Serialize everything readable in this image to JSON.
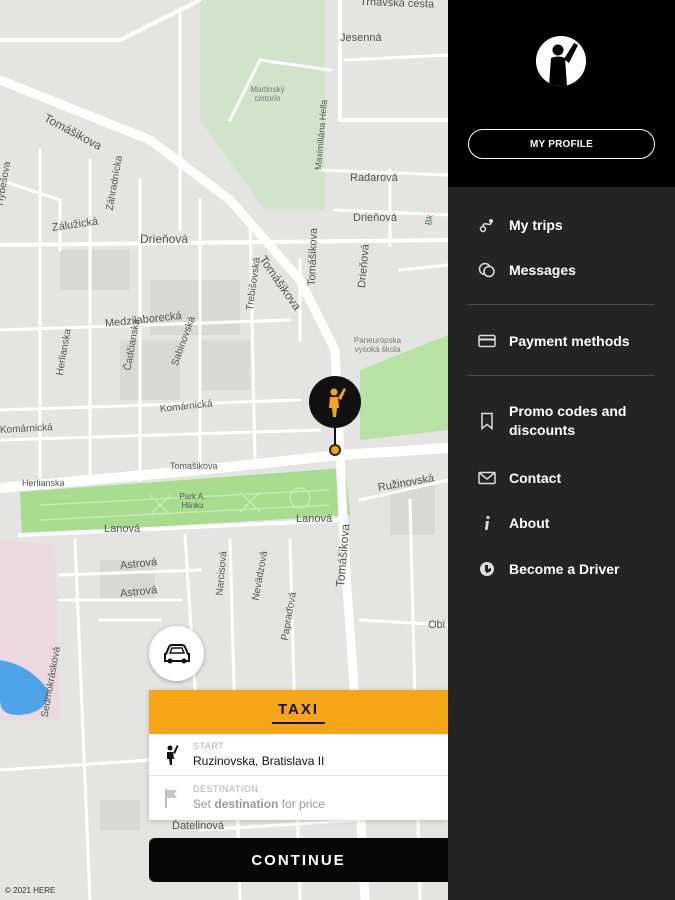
{
  "map": {
    "streets": [
      {
        "id": "trnavska",
        "text": "Trnavská cesta"
      },
      {
        "id": "jesenna",
        "text": "Jesenná"
      },
      {
        "id": "tomasikova-nw",
        "text": "Tomášikova"
      },
      {
        "id": "maximiliana-hella",
        "text": "Maximiliána Hella"
      },
      {
        "id": "radarova",
        "text": "Radarová"
      },
      {
        "id": "hybesova",
        "text": "Hybešova"
      },
      {
        "id": "zalucicka",
        "text": "Zálužická"
      },
      {
        "id": "zahradnicka",
        "text": "Záhradnícka"
      },
      {
        "id": "drienova-w",
        "text": "Drieňová"
      },
      {
        "id": "drienova-e",
        "text": "Drieňová"
      },
      {
        "id": "drienova-v",
        "text": "Drieňová"
      },
      {
        "id": "tomasikova-mid",
        "text": "Tomášikova"
      },
      {
        "id": "tomasikova-v",
        "text": "Tomášikova"
      },
      {
        "id": "trebisovska",
        "text": "Trebišovská"
      },
      {
        "id": "medzilaborecka",
        "text": "Medzilaborecká"
      },
      {
        "id": "hertnanska",
        "text": "Herlianska"
      },
      {
        "id": "cadcovska",
        "text": "Čadčianska"
      },
      {
        "id": "sabinovska",
        "text": "Sabinovská"
      },
      {
        "id": "komarnicka",
        "text": "Komárnická"
      },
      {
        "id": "komarnicka-w",
        "text": "Komárnická"
      },
      {
        "id": "tomasikova-stop",
        "text": "Tomašikova"
      },
      {
        "id": "herlianska-stop",
        "text": "Herlianska"
      },
      {
        "id": "ruzinovska",
        "text": "Ružinovská"
      },
      {
        "id": "lanova-w",
        "text": "Lanová"
      },
      {
        "id": "lanova-e",
        "text": "Lanová"
      },
      {
        "id": "astrova-1",
        "text": "Astrová"
      },
      {
        "id": "astrova-2",
        "text": "Astrová"
      },
      {
        "id": "narcisova",
        "text": "Narcisová"
      },
      {
        "id": "nevadzova",
        "text": "Nevädzová"
      },
      {
        "id": "papradova",
        "text": "Papraďová"
      },
      {
        "id": "tomasikova-s",
        "text": "Tomášikova"
      },
      {
        "id": "sedmokraskova",
        "text": "Sedmokrásková"
      },
      {
        "id": "datelinova",
        "text": "Ďatelinová"
      },
      {
        "id": "obi",
        "text": "Obi"
      },
      {
        "id": "bk",
        "text": "Bk"
      }
    ],
    "pois": {
      "cemetery": "Martinský cintorín",
      "school": "Paneurópska vysoká škola",
      "park": "Park A. Hlinku"
    },
    "copyright": "© 2021 HERE"
  },
  "booking": {
    "tab": "TAXI",
    "start_label": "START",
    "start_value": "Ruzinovska, Bratislava II",
    "destination_label": "DESTINATION",
    "destination_prefix": "Set",
    "destination_bold": "destination",
    "destination_suffix": "for price",
    "continue": "CONTINUE"
  },
  "drawer": {
    "profile_button": "MY PROFILE",
    "items": [
      {
        "label": "My trips",
        "icon": "route-icon"
      },
      {
        "label": "Messages",
        "icon": "chat-bubbles-icon"
      },
      {
        "label": "Payment methods",
        "icon": "credit-card-icon"
      },
      {
        "label": "Promo codes and discounts",
        "icon": "bookmark-icon"
      },
      {
        "label": "Contact",
        "icon": "envelope-icon"
      },
      {
        "label": "About",
        "icon": "info-icon"
      },
      {
        "label": "Become a Driver",
        "icon": "driver-icon"
      }
    ]
  },
  "colors": {
    "accent": "#f5a516",
    "drawer_bg": "#242424",
    "park": "#a8dc8e"
  }
}
